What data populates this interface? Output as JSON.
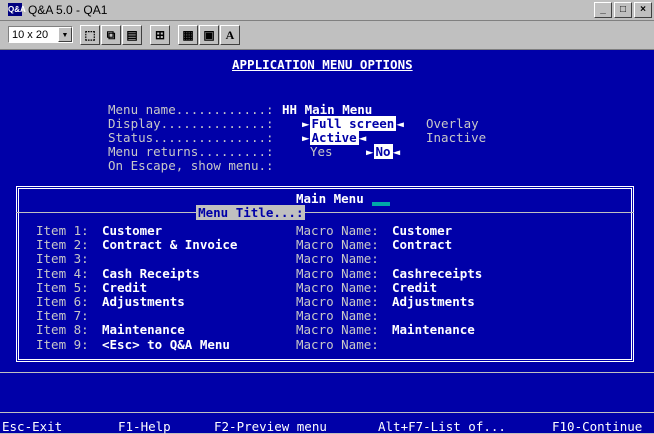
{
  "window": {
    "title": "Q&A 5.0 - QA1",
    "icon_text": "Q&A",
    "minimize": "_",
    "maximize": "□",
    "close": "×"
  },
  "toolbar": {
    "font_size": "10 x 20",
    "icons": [
      "select-icon",
      "copy-icon",
      "paste-icon",
      "fullscreen-icon",
      "properties-icon",
      "background-icon",
      "font-icon"
    ]
  },
  "screen": {
    "header": "APPLICATION MENU OPTIONS",
    "fields": {
      "menu_name_label": "Menu name............:",
      "menu_name_value": "HH Main Menu",
      "display_label": "Display..............:",
      "display_selected": "Full screen",
      "display_other": "Overlay",
      "status_label": "Status...............:",
      "status_selected": "Active",
      "status_other": "Inactive",
      "menu_returns_label": "Menu returns.........:",
      "menu_returns_yes": "Yes",
      "menu_returns_selected": "No",
      "escape_label": "On Escape, show menu.:"
    },
    "menu_title_label": "Menu Title...:",
    "menu_title_value": "Main Menu",
    "items": [
      {
        "label": "Item 1:",
        "name": "Customer",
        "macro_label": "Macro Name:",
        "macro": "Customer"
      },
      {
        "label": "Item 2:",
        "name": "Contract & Invoice",
        "macro_label": "Macro Name:",
        "macro": "Contract"
      },
      {
        "label": "Item 3:",
        "name": "",
        "macro_label": "Macro Name:",
        "macro": ""
      },
      {
        "label": "Item 4:",
        "name": "Cash Receipts",
        "macro_label": "Macro Name:",
        "macro": "Cashreceipts"
      },
      {
        "label": "Item 5:",
        "name": "Credit",
        "macro_label": "Macro Name:",
        "macro": "Credit"
      },
      {
        "label": "Item 6:",
        "name": "Adjustments",
        "macro_label": "Macro Name:",
        "macro": "Adjustments"
      },
      {
        "label": "Item 7:",
        "name": "",
        "macro_label": "Macro Name:",
        "macro": ""
      },
      {
        "label": "Item 8:",
        "name": "Maintenance",
        "macro_label": "Macro Name:",
        "macro": "Maintenance"
      },
      {
        "label": "Item 9:",
        "name": "<Esc> to Q&A Menu",
        "macro_label": "Macro Name:",
        "macro": ""
      }
    ]
  },
  "status_bar": {
    "esc": "Esc-Exit",
    "f1": "F1-Help",
    "f2": "F2-Preview menu",
    "altf7": "Alt+F7-List of...",
    "f10": "F10-Continue"
  }
}
